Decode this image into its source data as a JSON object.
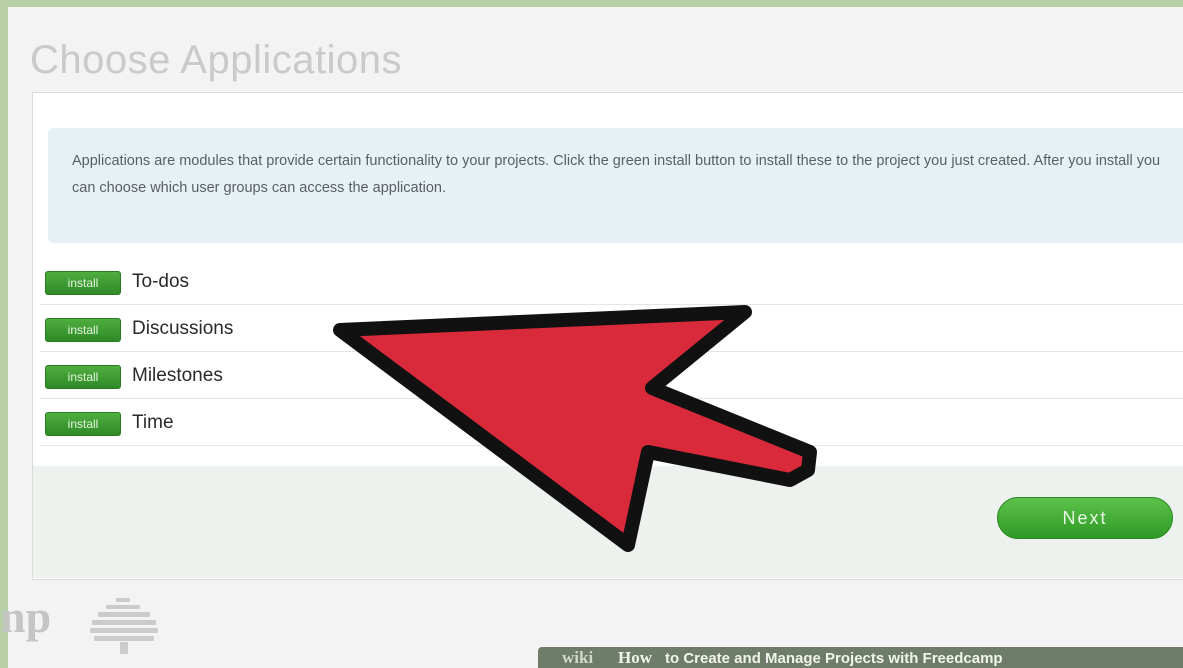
{
  "page": {
    "title": "Choose Applications",
    "description": "Applications are modules that provide certain functionality to your projects. Click the green install button to install these to the project you just created. After you install you can choose which user groups can access the application."
  },
  "applications": [
    {
      "button_label": "install",
      "name": "To-dos"
    },
    {
      "button_label": "install",
      "name": "Discussions"
    },
    {
      "button_label": "install",
      "name": "Milestones"
    },
    {
      "button_label": "install",
      "name": "Time"
    }
  ],
  "footer": {
    "next_label": "Next",
    "logo_text": "np"
  },
  "watermark": {
    "brand_wiki": "wiki",
    "brand_how": "How",
    "title": "to Create and Manage Projects with Freedcamp"
  },
  "colors": {
    "install_green": "#3f9d33",
    "next_green": "#45ad38",
    "info_box": "#e6f1f5",
    "arrow_red": "#d92a3b",
    "arrow_outline": "#111111"
  },
  "icons": {
    "arrow": "red-arrow-pointer-icon",
    "logo": "freedcamp-tree-logo-icon"
  }
}
